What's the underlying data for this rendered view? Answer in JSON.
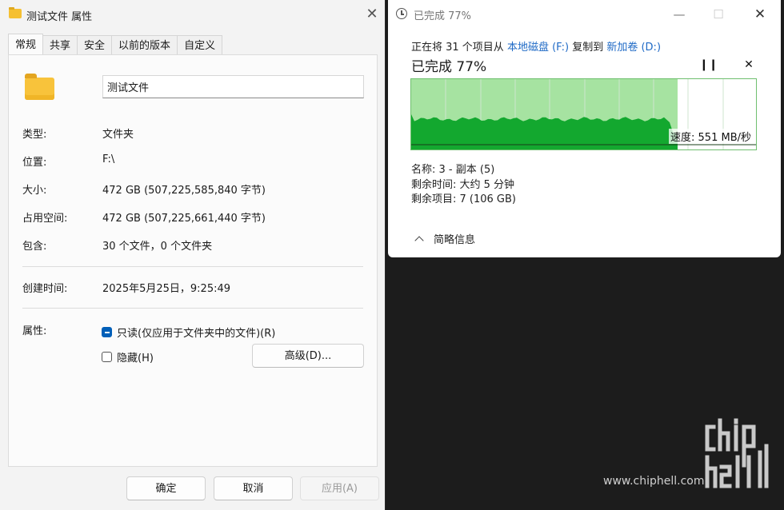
{
  "props_dialog": {
    "title": "测试文件 属性",
    "tabs": [
      "常规",
      "共享",
      "安全",
      "以前的版本",
      "自定义"
    ],
    "folder_name": "测试文件",
    "rows": {
      "type_label": "类型:",
      "type_value": "文件夹",
      "location_label": "位置:",
      "location_value": "F:\\",
      "size_label": "大小:",
      "size_value": "472 GB (507,225,585,840 字节)",
      "disk_label": "占用空间:",
      "disk_value": "472 GB (507,225,661,440 字节)",
      "contains_label": "包含:",
      "contains_value": "30 个文件，0 个文件夹",
      "created_label": "创建时间:",
      "created_value": "2025年5月25日，9:25:49",
      "attributes_label": "属性:"
    },
    "readonly_label": "只读(仅应用于文件夹中的文件)(R)",
    "readonly_checked": true,
    "hidden_label": "隐藏(H)",
    "hidden_checked": false,
    "advanced_button": "高级(D)...",
    "ok_button": "确定",
    "cancel_button": "取消",
    "apply_button": "应用(A)"
  },
  "copy_dialog": {
    "title": "已完成 77%",
    "line_prefix": "正在将 31 个项目从 ",
    "source": "本地磁盘 (F:)",
    "line_middle": " 复制到 ",
    "destination": "新加卷 (D:)",
    "progress_text": "已完成 77%",
    "progress_percent": 77,
    "speed_text": "速度: 551 MB/秒",
    "name_line": "名称:  3 - 副本 (5)",
    "time_left_line": "剩余时间:  大约 5 分钟",
    "items_left_line": "剩余项目:  7 (106 GB)",
    "details_label": "简略信息",
    "accent_fill": "#a6e3a1",
    "accent_graph": "#13a82f"
  },
  "watermark": {
    "logo_text": "chip hell",
    "url": "www.chiphell.com"
  }
}
